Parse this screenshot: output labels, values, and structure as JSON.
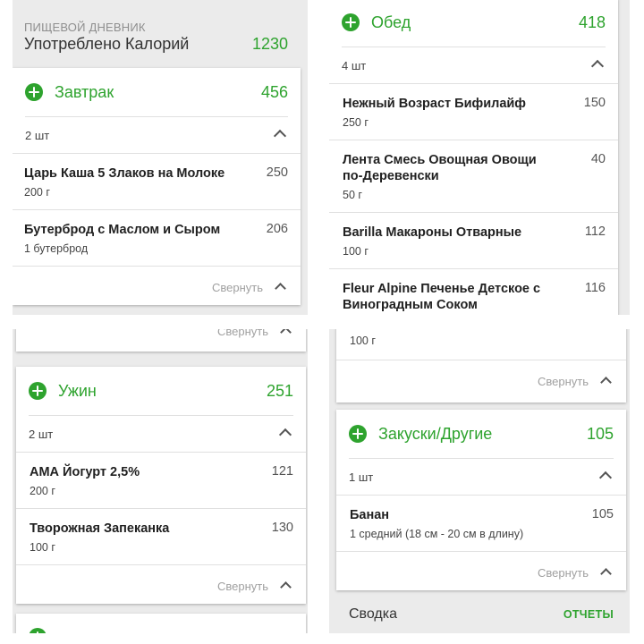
{
  "diary": {
    "kicker": "ПИЩЕВОЙ ДНЕВНИК",
    "title": "Употреблено Калорий",
    "total": "1230"
  },
  "breakfast": {
    "name": "Завтрак",
    "calories": "456",
    "count": "2 шт",
    "items": [
      {
        "name": "Царь Каша 5 Злаков на Молоке",
        "serving": "200  г",
        "calories": "250"
      },
      {
        "name": "Бутерброд с Маслом и Сыром",
        "serving": "1  бутерброд",
        "calories": "206"
      }
    ],
    "collapse_label": "Свернуть"
  },
  "lunch": {
    "name": "Обед",
    "calories": "418",
    "count": "4 шт",
    "items": [
      {
        "name": "Нежный Возраст Бифилайф",
        "serving": "250 г",
        "calories": "150"
      },
      {
        "name": "Лента Смесь Овощная Овощи по-Деревенски",
        "serving": "50 г",
        "calories": "40"
      },
      {
        "name": "Barilla Макароны Отварные",
        "serving": "100 г",
        "calories": "112"
      },
      {
        "name": "Fleur Alpine Печенье Детское с Виноградным Соком",
        "serving": "100 г",
        "calories": "116"
      }
    ],
    "collapse_label": "Свернуть"
  },
  "dinner": {
    "name": "Ужин",
    "calories": "251",
    "count": "2 шт",
    "items": [
      {
        "name": "АМА Йогурт 2,5%",
        "serving": "200 г",
        "calories": "121"
      },
      {
        "name": "Творожная Запеканка",
        "serving": "100 г",
        "calories": "130"
      }
    ],
    "collapse_label": "Свернуть"
  },
  "snacks": {
    "name": "Закуски/Другие",
    "calories": "105",
    "count": "1 шт",
    "items": [
      {
        "name": "Банан",
        "serving": "1 средний (18 см - 20 см в длину)",
        "calories": "105"
      }
    ],
    "collapse_label": "Свернуть"
  },
  "summary": {
    "label": "Сводка",
    "reports": "ОТЧЕТЫ"
  },
  "colors": {
    "accent": "#2ea32e",
    "background": "#ebebeb"
  }
}
